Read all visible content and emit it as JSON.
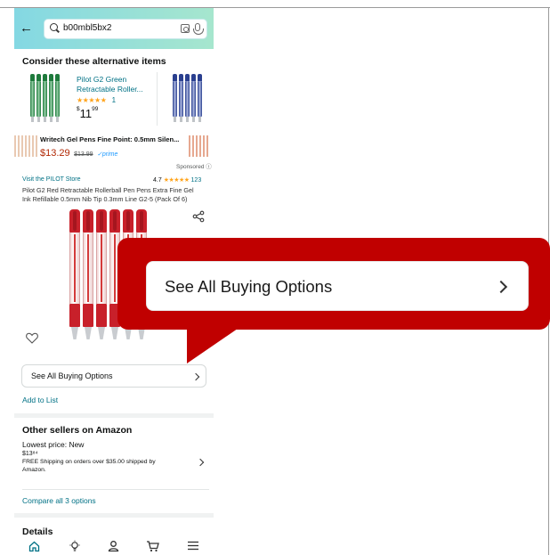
{
  "search": {
    "query": "b00mbl5bx2"
  },
  "alternatives": {
    "title": "Consider these alternative items",
    "item": {
      "name_line1": "Pilot G2 Green",
      "name_line2": "Retractable Roller...",
      "stars": "★★★★★",
      "review_count": "1",
      "price_symbol": "$",
      "price_whole": "11",
      "price_fraction": "99"
    }
  },
  "sponsored_item": {
    "title": "Writech Gel Pens Fine Point: 0.5mm Silen...",
    "price": "$13.29",
    "old_price": "$13.99",
    "prime": "✓prime",
    "sponsored_label": "Sponsored ⓘ"
  },
  "product": {
    "store_link": "Visit the PILOT Store",
    "rating": "4.7",
    "stars": "★★★★★",
    "rating_count": "123",
    "title_line1": "Pilot G2 Red Retractable Rollerball Pen Pens Extra Fine Gel",
    "title_line2": "Ink Refillable 0.5mm Nib Tip 0.3mm Line G2-5 (Pack Of 6)"
  },
  "buttons": {
    "see_all_buying_options": "See All Buying Options",
    "add_to_list": "Add to List",
    "compare_all": "Compare all 3 options"
  },
  "other_sellers": {
    "title": "Other sellers on Amazon",
    "lowest_price_label": "Lowest price: New",
    "price": "$13⁸⁴",
    "shipping_line1": "FREE Shipping on orders over $35.00 shipped by",
    "shipping_line2": "Amazon."
  },
  "details": {
    "title": "Details"
  },
  "colors": {
    "accent_red": "#c00000",
    "link": "#007185",
    "pen_red": "#c8202a",
    "pen_green": "#1e7a3c",
    "pen_blue": "#2a3f8f"
  },
  "icons": [
    "back-arrow-icon",
    "search-icon",
    "camera-icon",
    "mic-icon",
    "share-icon",
    "heart-icon",
    "chevron-right-icon",
    "home-icon",
    "lightbulb-icon",
    "account-icon",
    "cart-icon",
    "menu-icon"
  ]
}
